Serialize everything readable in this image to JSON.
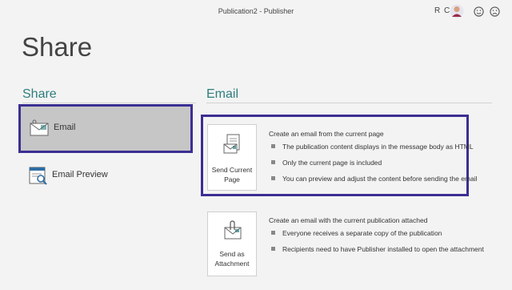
{
  "window": {
    "title": "Publication2 - Publisher",
    "user_initials": "R C"
  },
  "page_title": "Share",
  "left": {
    "heading": "Share",
    "items": [
      {
        "label": "Email",
        "icon": "email-icon",
        "selected": true
      },
      {
        "label": "Email Preview",
        "icon": "email-preview-icon",
        "selected": false
      }
    ]
  },
  "right": {
    "heading": "Email",
    "options": [
      {
        "button_line1": "Send Current",
        "button_line2": "Page",
        "icon": "send-page-icon",
        "lead": "Create an email from the current page",
        "bullets": [
          "The publication content displays in the message body as HTML",
          "Only the current page is included",
          "You can preview and adjust the content before sending the email"
        ]
      },
      {
        "button_line1": "Send as",
        "button_line2": "Attachment",
        "icon": "attachment-icon",
        "lead": "Create an email with the current publication attached",
        "bullets": [
          "Everyone receives a separate copy of the publication",
          "Recipients need to have Publisher installed to open the attachment"
        ]
      }
    ]
  },
  "colors": {
    "accent": "#2e7d7d",
    "highlight_border": "#3b2f92",
    "selected_bg": "#c6c6c6"
  }
}
